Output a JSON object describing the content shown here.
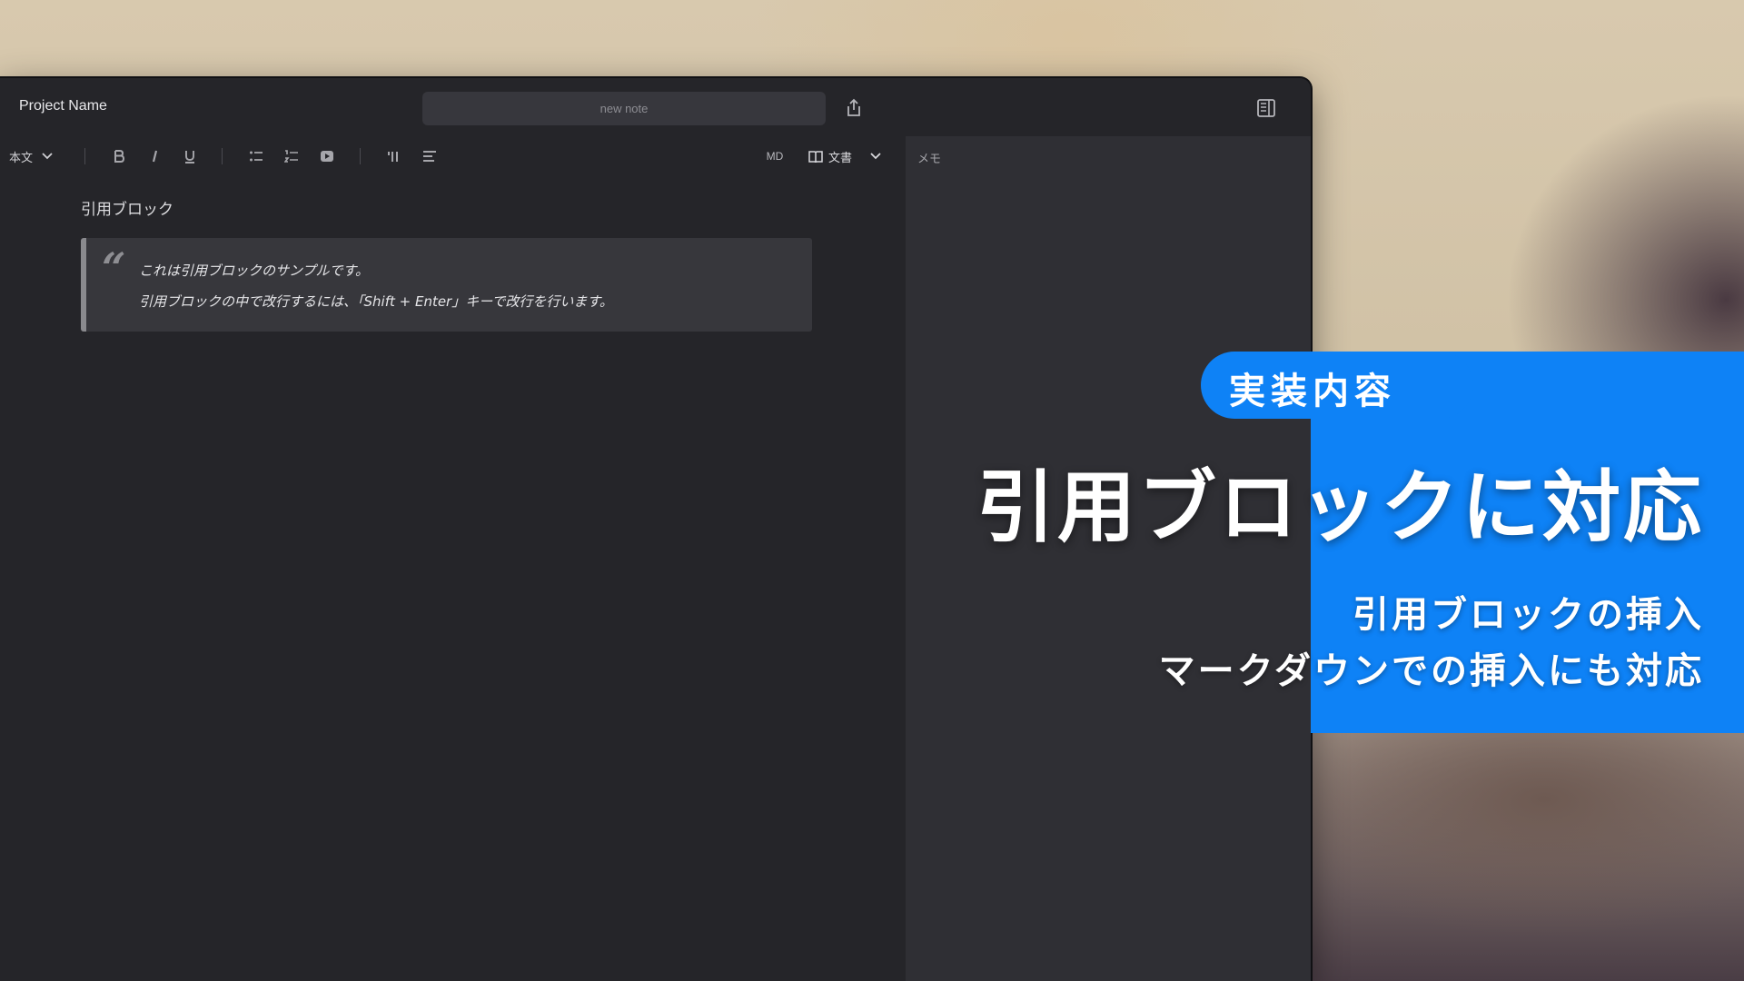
{
  "header": {
    "project_name": "Project Name",
    "note_title": "new note"
  },
  "toolbar": {
    "style_select": "本文",
    "mode_label": "MD",
    "view_select": "文書",
    "icons": [
      "bold-icon",
      "italic-icon",
      "underline-icon",
      "bullet-list-icon",
      "numbered-list-icon",
      "video-embed-icon",
      "quote-block-icon",
      "align-icon",
      "book-icon",
      "chevron-down-icon",
      "share-icon",
      "side-panel-icon"
    ]
  },
  "editor": {
    "heading": "引用ブロック",
    "quote_lines": [
      "これは引用ブロックのサンプルです。",
      "引用ブロックの中で改行するには、「Shift + Enter」キーで改行を行います。"
    ]
  },
  "side_panel": {
    "label": "メモ"
  },
  "promo": {
    "pill": "実装内容",
    "headline": "引用ブロックに対応",
    "sublines": [
      "引用ブロックの挿入",
      "マークダウンでの挿入にも対応"
    ],
    "accent_color": "#0e82f6"
  }
}
